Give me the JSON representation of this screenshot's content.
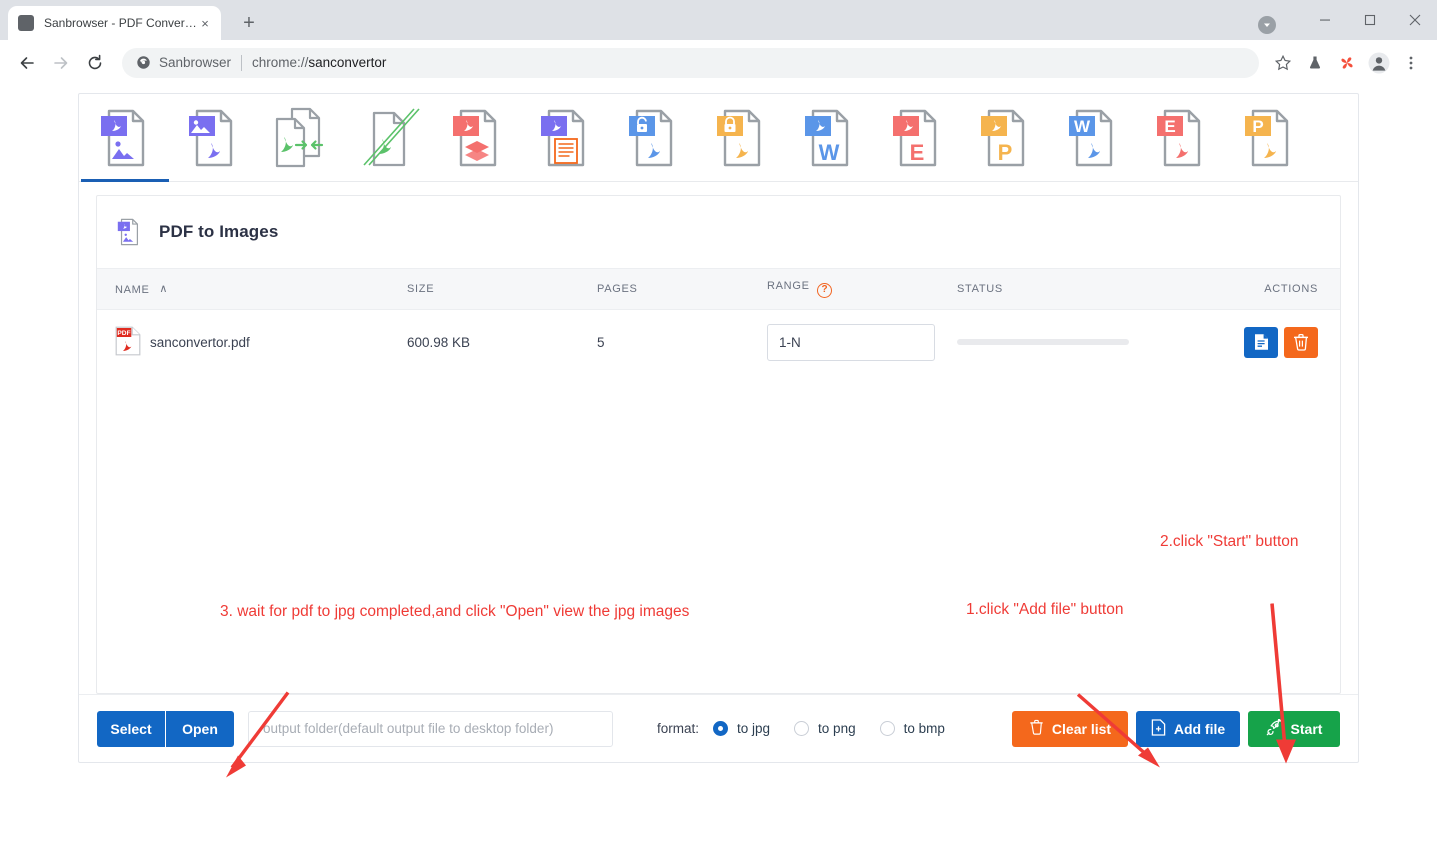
{
  "browser": {
    "tab": {
      "title": "Sanbrowser - PDF Convertor",
      "close_label": "×",
      "favicon": "app-favicon"
    },
    "new_tab_label": "+",
    "window_controls": {
      "minimize": "—",
      "maximize": "□",
      "close": "×"
    },
    "omnibox": {
      "site_name": "Sanbrowser",
      "url_scheme": "chrome://",
      "url_path": "sanconvertor",
      "icons": [
        "back-icon",
        "forward-icon",
        "reload-icon",
        "site-shield-icon",
        "bookmark-star-icon",
        "experiments-flask-icon",
        "extension-pinwheel-icon",
        "profile-avatar-icon",
        "chrome-menu-icon"
      ]
    }
  },
  "toolbar": {
    "tools": [
      {
        "name": "pdf-to-images",
        "badge": "#7a6ff0",
        "badge_glyph": "acrobat",
        "sub": "image",
        "sub_color": "#7a6ff0",
        "active": true
      },
      {
        "name": "images-to-pdf",
        "badge": "#7a6ff0",
        "badge_glyph": "image",
        "sub": "acrobat",
        "sub_color": "#7a6ff0",
        "active": false
      },
      {
        "name": "merge-pdf",
        "badge": "",
        "badge_glyph": "",
        "sub": "merge",
        "sub_color": "#5bc26a",
        "active": false
      },
      {
        "name": "split-pdf",
        "badge": "",
        "badge_glyph": "",
        "sub": "split",
        "sub_color": "#5bc26a",
        "active": false
      },
      {
        "name": "compress-pdf",
        "badge": "#f4706e",
        "badge_glyph": "acrobat",
        "sub": "layers",
        "sub_color": "#f4706e",
        "active": false
      },
      {
        "name": "pdf-to-text",
        "badge": "#7a6ff0",
        "badge_glyph": "acrobat",
        "sub": "text",
        "sub_color": "#f4681c",
        "active": false
      },
      {
        "name": "unlock-pdf",
        "badge": "#5b96e8",
        "badge_glyph": "unlock",
        "sub": "acrobat",
        "sub_color": "#5b96e8",
        "active": false
      },
      {
        "name": "lock-pdf",
        "badge": "#f5b44e",
        "badge_glyph": "lock",
        "sub": "acrobat",
        "sub_color": "#f5b44e",
        "active": false
      },
      {
        "name": "pdf-to-word",
        "badge": "#5b96e8",
        "badge_glyph": "acrobat",
        "sub": "W",
        "sub_color": "#5b96e8",
        "active": false
      },
      {
        "name": "pdf-to-excel",
        "badge": "#f4706e",
        "badge_glyph": "acrobat",
        "sub": "E",
        "sub_color": "#f4706e",
        "active": false
      },
      {
        "name": "pdf-to-powerpoint",
        "badge": "#f5b44e",
        "badge_glyph": "acrobat",
        "sub": "P",
        "sub_color": "#f5b44e",
        "active": false
      },
      {
        "name": "word-to-pdf",
        "badge": "#5b96e8",
        "badge_glyph": "W",
        "sub": "acrobat",
        "sub_color": "#5b96e8",
        "active": false
      },
      {
        "name": "excel-to-pdf",
        "badge": "#f4706e",
        "badge_glyph": "E",
        "sub": "acrobat",
        "sub_color": "#f4706e",
        "active": false
      },
      {
        "name": "powerpoint-to-pdf",
        "badge": "#f5b44e",
        "badge_glyph": "P",
        "sub": "acrobat",
        "sub_color": "#f5b44e",
        "active": false
      }
    ]
  },
  "panel": {
    "title": "PDF to Images",
    "icon": "pdf-to-images-icon",
    "columns": {
      "name": "NAME",
      "size": "SIZE",
      "pages": "PAGES",
      "range": "RANGE",
      "range_help": "?",
      "status": "STATUS",
      "actions": "ACTIONS"
    },
    "sort": {
      "column": "NAME",
      "direction": "asc",
      "caret": "∧"
    },
    "rows": [
      {
        "file_name": "sanconvertor.pdf",
        "file_badge": "PDF",
        "size": "600.98 KB",
        "pages": "5",
        "range_value": "1-N",
        "status_progress": 0,
        "actions": [
          "open-file-button",
          "delete-file-button"
        ]
      }
    ]
  },
  "footer": {
    "select_label": "Select",
    "open_label": "Open",
    "output_placeholder": "output folder(default output file to desktop folder)",
    "output_value": "",
    "format_label": "format:",
    "format_options": [
      {
        "label": "to jpg",
        "selected": true
      },
      {
        "label": "to png",
        "selected": false
      },
      {
        "label": "to bmp",
        "selected": false
      }
    ],
    "clear_label": "Clear list",
    "add_label": "Add file",
    "start_label": "Start"
  },
  "annotations": [
    {
      "name": "annotation-step-3",
      "text": "3. wait for pdf to jpg completed,and click \"Open\" view the jpg images"
    },
    {
      "name": "annotation-step-1",
      "text": "1.click \"Add file\" button"
    },
    {
      "name": "annotation-step-2",
      "text": "2.click \"Start\" button"
    }
  ],
  "colors": {
    "accent_blue": "#1267c4",
    "accent_orange": "#f4681c",
    "accent_green": "#16a34a",
    "annotation_red": "#ef3b36",
    "purple": "#7a6ff0"
  }
}
